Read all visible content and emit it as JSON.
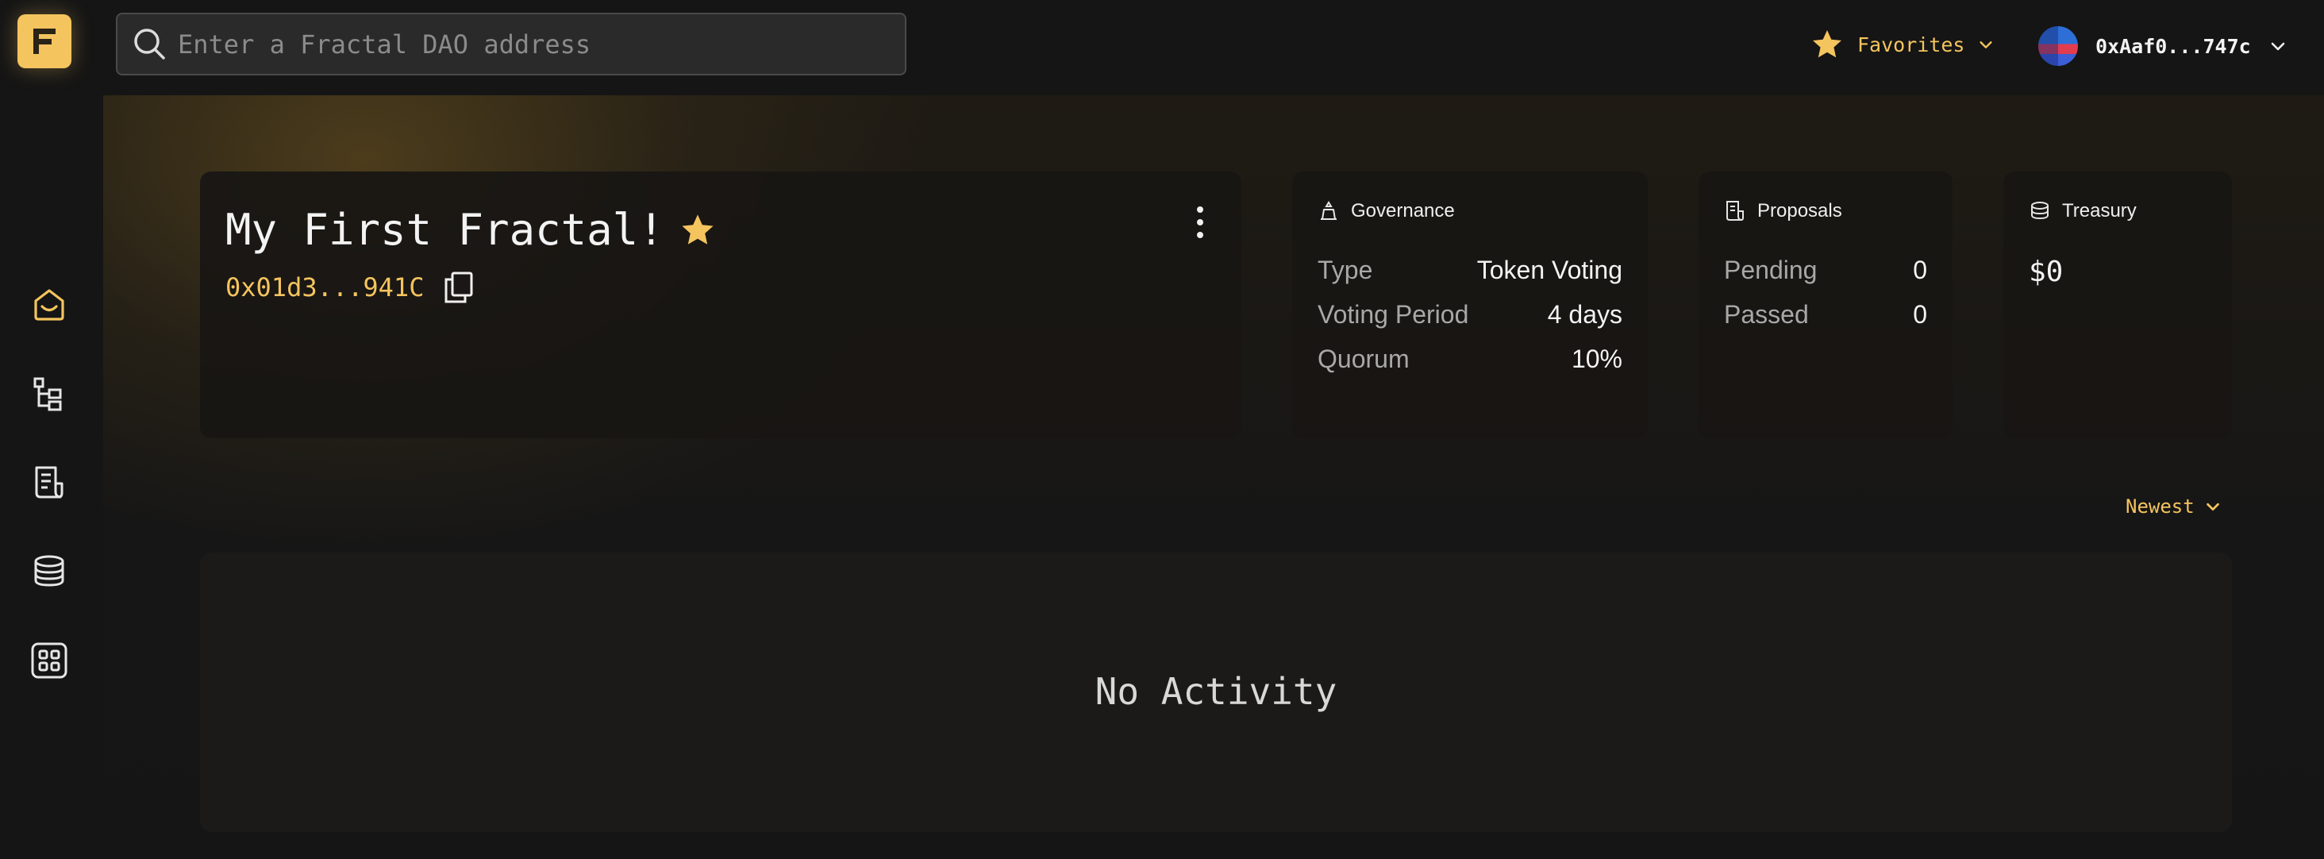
{
  "app": {
    "logo_letter": "F",
    "accent_color": "#f4c45e"
  },
  "search": {
    "placeholder": "Enter a Fractal DAO address",
    "value": ""
  },
  "header": {
    "favorites_label": "Favorites",
    "account_address": "0xAaf0...747c"
  },
  "sidebar": {
    "items": [
      {
        "name": "home",
        "icon": "home-icon",
        "active": true
      },
      {
        "name": "hierarchy",
        "icon": "hierarchy-icon",
        "active": false
      },
      {
        "name": "proposals",
        "icon": "document-icon",
        "active": false
      },
      {
        "name": "treasury",
        "icon": "coins-icon",
        "active": false
      },
      {
        "name": "apps",
        "icon": "apps-grid-icon",
        "active": false
      }
    ]
  },
  "dao": {
    "name": "My First Fractal!",
    "address": "0x01d3...941C",
    "favorited": true
  },
  "governance": {
    "title": "Governance",
    "rows": [
      {
        "label": "Type",
        "value": "Token Voting"
      },
      {
        "label": "Voting Period",
        "value": "4 days"
      },
      {
        "label": "Quorum",
        "value": "10%"
      }
    ]
  },
  "proposals": {
    "title": "Proposals",
    "rows": [
      {
        "label": "Pending",
        "value": "0"
      },
      {
        "label": "Passed",
        "value": "0"
      }
    ]
  },
  "treasury": {
    "title": "Treasury",
    "value": "$0"
  },
  "activity": {
    "sort_label": "Newest",
    "empty_text": "No Activity"
  }
}
